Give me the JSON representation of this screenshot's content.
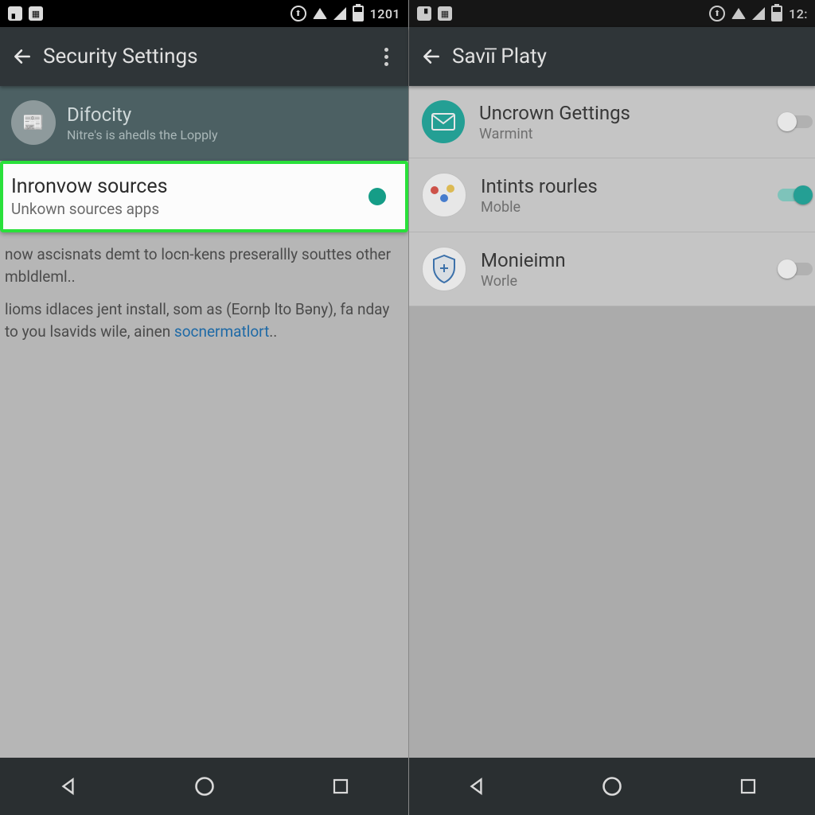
{
  "status": {
    "clock_left": "1201",
    "clock_right": "12:"
  },
  "left": {
    "title": "Security Settings",
    "difocity": {
      "title": "Difocity",
      "subtitle": "Nitre's is ahedls the Lopply"
    },
    "unknown": {
      "title": "Inronvow sources",
      "subtitle": "Unkown sources apps"
    },
    "para1": "now ascisnats demt to locn-kens preserallly souttes other mbldleml..",
    "para2_a": "lioms idlaces jent install, som as (Eornþ lto Bəny), fa nday to you lsavids wile, ainen ",
    "para2_link": "socnermatlort",
    "para2_b": ".."
  },
  "right": {
    "title": "Savīī Platy",
    "rows": [
      {
        "icon": "mail",
        "title": "Uncrown Gettings",
        "subtitle": "Warmint",
        "state": "off"
      },
      {
        "icon": "multi",
        "title": "Intints rourles",
        "subtitle": "Moble",
        "state": "on"
      },
      {
        "icon": "shield",
        "title": "Monieimn",
        "subtitle": "Worle",
        "state": "off"
      }
    ]
  }
}
